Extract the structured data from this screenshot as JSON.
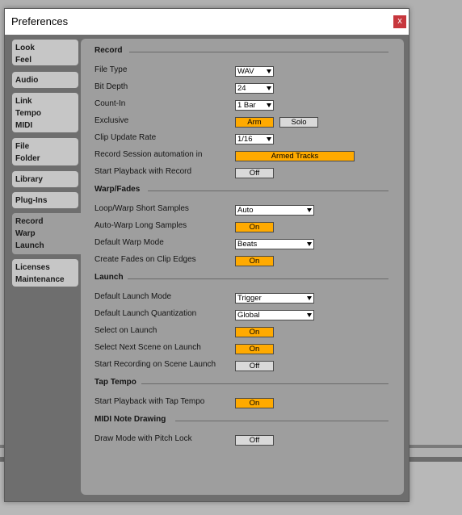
{
  "window": {
    "title": "Preferences",
    "close_label": "x"
  },
  "tabs": [
    [
      "Look",
      "Feel"
    ],
    [
      "Audio"
    ],
    [
      "Link",
      "Tempo",
      "MIDI"
    ],
    [
      "File",
      "Folder"
    ],
    [
      "Library"
    ],
    [
      "Plug-Ins"
    ],
    [
      "Record",
      "Warp",
      "Launch"
    ],
    [
      "Licenses",
      "Maintenance"
    ]
  ],
  "sections": {
    "record": "Record",
    "warp": "Warp/Fades",
    "launch": "Launch",
    "tap": "Tap Tempo",
    "midi": "MIDI Note Drawing"
  },
  "rows": {
    "file_type": {
      "label": "File Type",
      "value": "WAV"
    },
    "bit_depth": {
      "label": "Bit Depth",
      "value": "24"
    },
    "count_in": {
      "label": "Count-In",
      "value": "1 Bar"
    },
    "exclusive": {
      "label": "Exclusive",
      "arm": "Arm",
      "solo": "Solo"
    },
    "clip_update": {
      "label": "Clip Update Rate",
      "value": "1/16"
    },
    "record_automation": {
      "label": "Record Session automation in",
      "value": "Armed Tracks"
    },
    "start_playback_record": {
      "label": "Start Playback with Record",
      "value": "Off"
    },
    "loop_warp": {
      "label": "Loop/Warp Short Samples",
      "value": "Auto"
    },
    "auto_warp": {
      "label": "Auto-Warp Long Samples",
      "value": "On"
    },
    "default_warp": {
      "label": "Default Warp Mode",
      "value": "Beats"
    },
    "create_fades": {
      "label": "Create Fades on Clip Edges",
      "value": "On"
    },
    "launch_mode": {
      "label": "Default Launch Mode",
      "value": "Trigger"
    },
    "launch_quant": {
      "label": "Default Launch Quantization",
      "value": "Global"
    },
    "select_on_launch": {
      "label": "Select on Launch",
      "value": "On"
    },
    "select_next_scene": {
      "label": "Select Next Scene on Launch",
      "value": "On"
    },
    "start_recording_scene": {
      "label": "Start Recording on Scene Launch",
      "value": "Off"
    },
    "tap_playback": {
      "label": "Start Playback with Tap Tempo",
      "value": "On"
    },
    "pitch_lock": {
      "label": "Draw Mode with Pitch Lock",
      "value": "Off"
    }
  },
  "colors": {
    "on": "#ffaa00",
    "off": "#d9d9d9",
    "close": "#c7373d"
  }
}
